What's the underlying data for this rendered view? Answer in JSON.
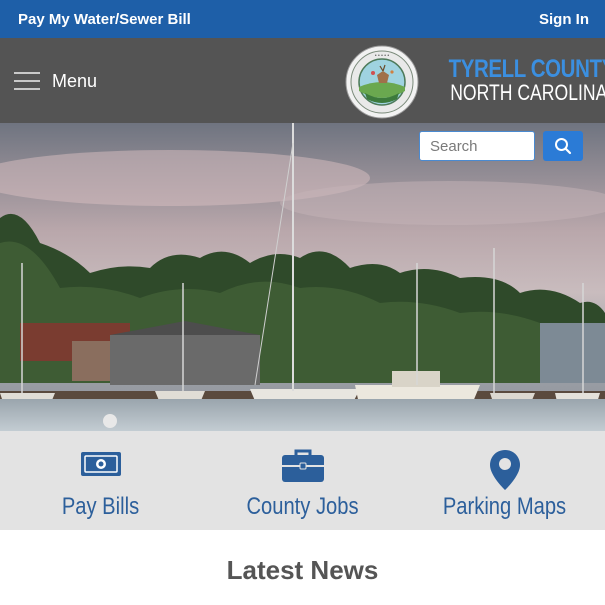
{
  "topbar": {
    "pay_bill_link": "Pay My Water/Sewer Bill",
    "sign_in_link": "Sign In"
  },
  "header": {
    "menu_label": "Menu",
    "brand_line1": "TYRELL COUNTY",
    "brand_line2": "NORTH CAROLINA",
    "seal_icon": "county-seal"
  },
  "search": {
    "placeholder": "Search",
    "button_icon": "search-icon"
  },
  "quick_links": [
    {
      "label": "Pay Bills",
      "icon": "money-icon"
    },
    {
      "label": "County Jobs",
      "icon": "briefcase-icon"
    },
    {
      "label": "Parking Maps",
      "icon": "map-pin-icon"
    }
  ],
  "news": {
    "heading": "Latest News"
  },
  "colors": {
    "topbar": "#1e5fa8",
    "header": "#545454",
    "accent": "#2b7bd6",
    "link_text": "#2c5f9b",
    "quick_bg": "#e3e3e3"
  }
}
